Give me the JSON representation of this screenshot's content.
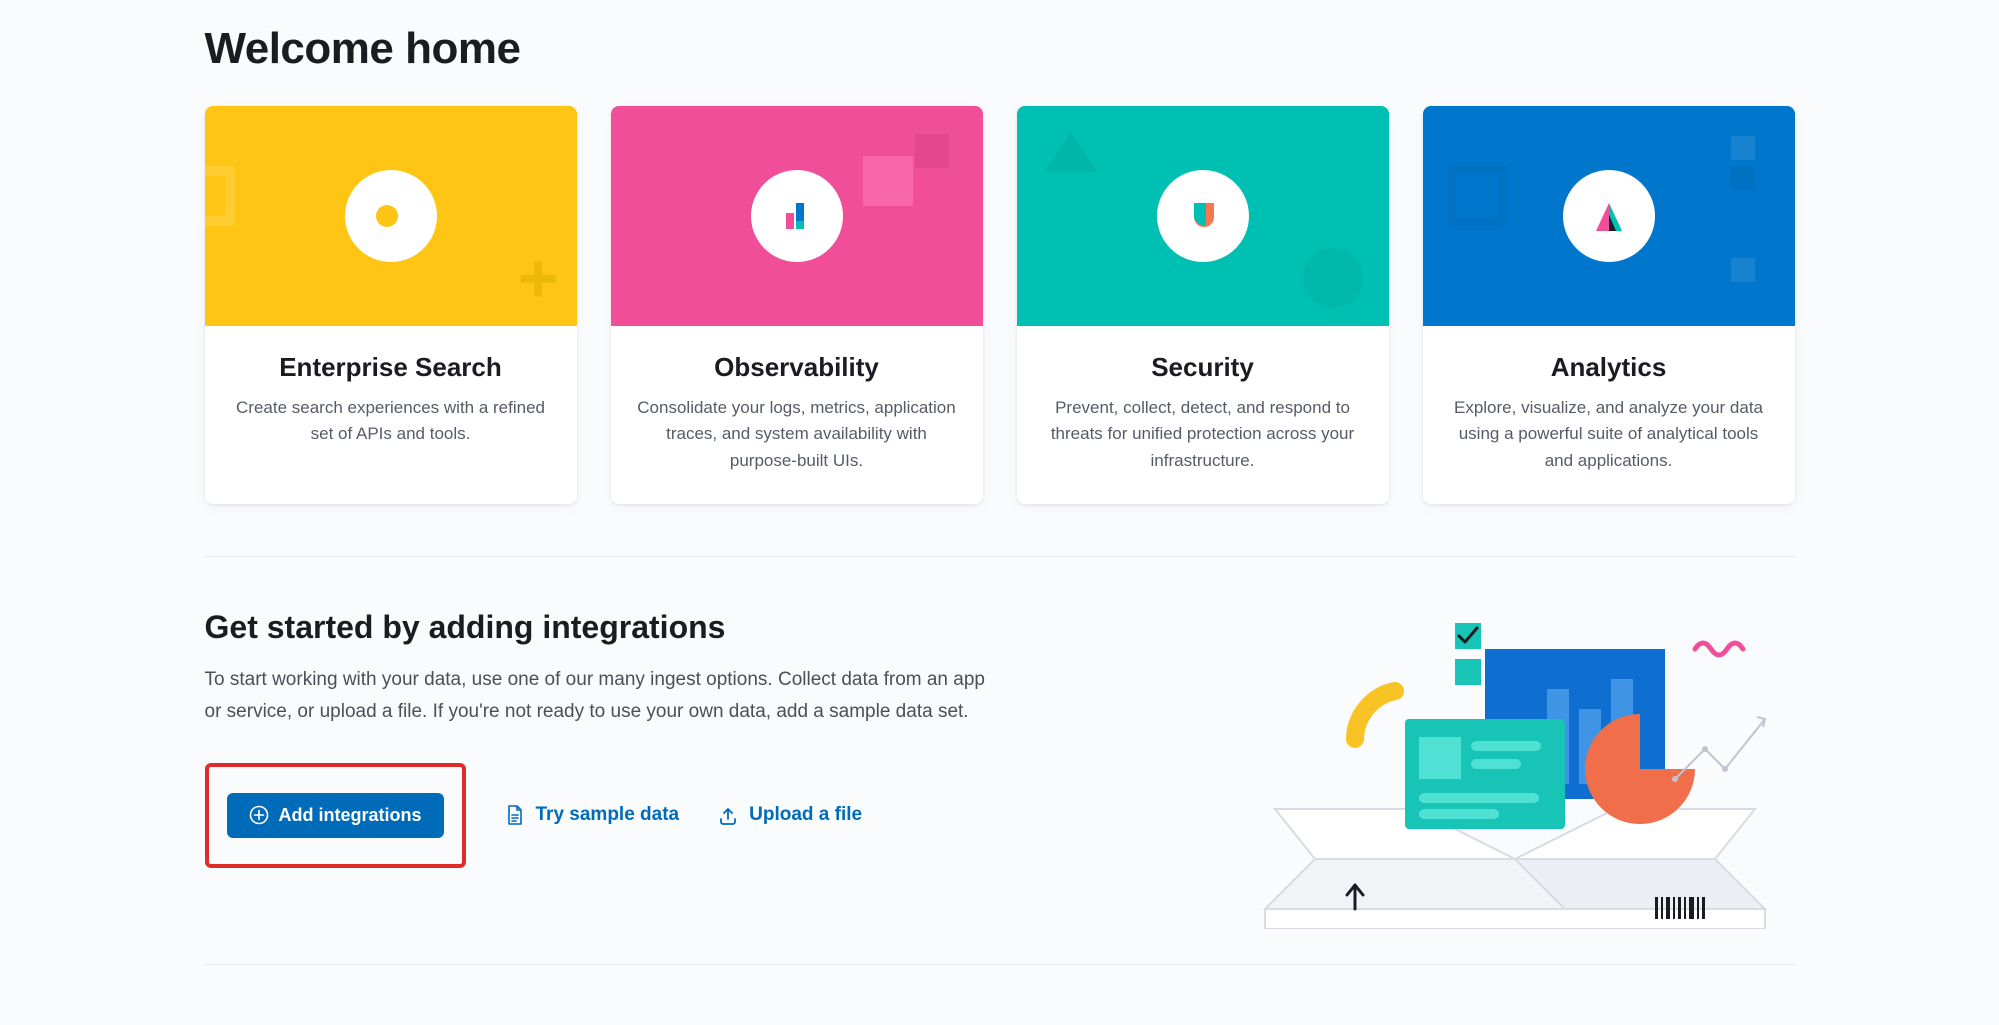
{
  "page": {
    "title": "Welcome home"
  },
  "cards": [
    {
      "title": "Enterprise Search",
      "desc": "Create search experiences with a refined set of APIs and tools."
    },
    {
      "title": "Observability",
      "desc": "Consolidate your logs, metrics, application traces, and system availability with purpose-built UIs."
    },
    {
      "title": "Security",
      "desc": "Prevent, collect, detect, and respond to threats for unified protection across your infrastructure."
    },
    {
      "title": "Analytics",
      "desc": "Explore, visualize, and analyze your data using a powerful suite of analytical tools and applications."
    }
  ],
  "get_started": {
    "heading": "Get started by adding integrations",
    "body": "To start working with your data, use one of our many ingest options. Collect data from an app or service, or upload a file. If you're not ready to use your own data, add a sample data set.",
    "add_label": "Add integrations",
    "sample_label": "Try sample data",
    "upload_label": "Upload a file"
  },
  "colors": {
    "yellow": "#fec514",
    "pink": "#f04e98",
    "teal": "#00bfb3",
    "blue": "#0077cc",
    "primary": "#006bb8",
    "highlight_border": "#e02b2b"
  }
}
